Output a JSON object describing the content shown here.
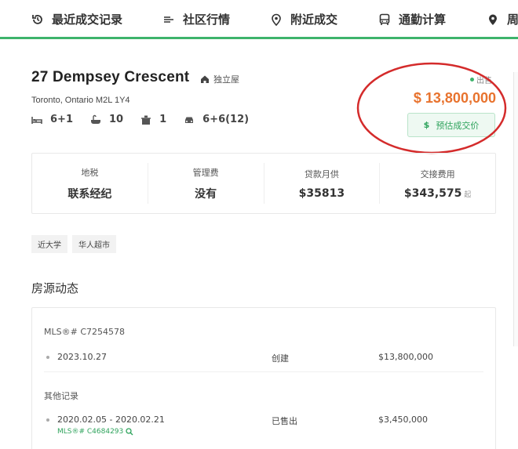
{
  "nav": {
    "items": [
      {
        "label": "最近成交记录",
        "icon": "history-icon"
      },
      {
        "label": "社区行情",
        "icon": "list-icon"
      },
      {
        "label": "附近成交",
        "icon": "location-pin-icon"
      },
      {
        "label": "通勤计算",
        "icon": "bus-icon"
      },
      {
        "label": "周",
        "icon": "map-pin-icon"
      }
    ],
    "accent": "#3db36b"
  },
  "listing": {
    "address": "27 Dempsey Crescent",
    "property_type": "独立屋",
    "city": "Toronto, Ontario M2L 1Y4",
    "bedrooms": "6+1",
    "bathrooms": "10",
    "kitchens": "1",
    "parking": "6+6(12)",
    "status": "出售",
    "price": "$ 13,800,000",
    "estimate_label": "预估成交价",
    "estimate_icon": "$",
    "price_color": "#e8732e"
  },
  "info": [
    {
      "label": "地税",
      "value": "联系经纪",
      "suffix": ""
    },
    {
      "label": "管理费",
      "value": "没有",
      "suffix": ""
    },
    {
      "label": "贷款月供",
      "value": "$35813",
      "suffix": ""
    },
    {
      "label": "交接费用",
      "value": "$343,575",
      "suffix": "起"
    }
  ],
  "tags": [
    "近大学",
    "华人超市"
  ],
  "history": {
    "title": "房源动态",
    "current_mls": "MLS®# C7254578",
    "current_record": {
      "date": "2023.10.27",
      "event": "创建",
      "price": "$13,800,000"
    },
    "other_title": "其他记录",
    "other_record": {
      "date": "2020.02.05 - 2020.02.21",
      "event": "已售出",
      "price": "$3,450,000",
      "mls": "MLS®# C4684293"
    }
  }
}
